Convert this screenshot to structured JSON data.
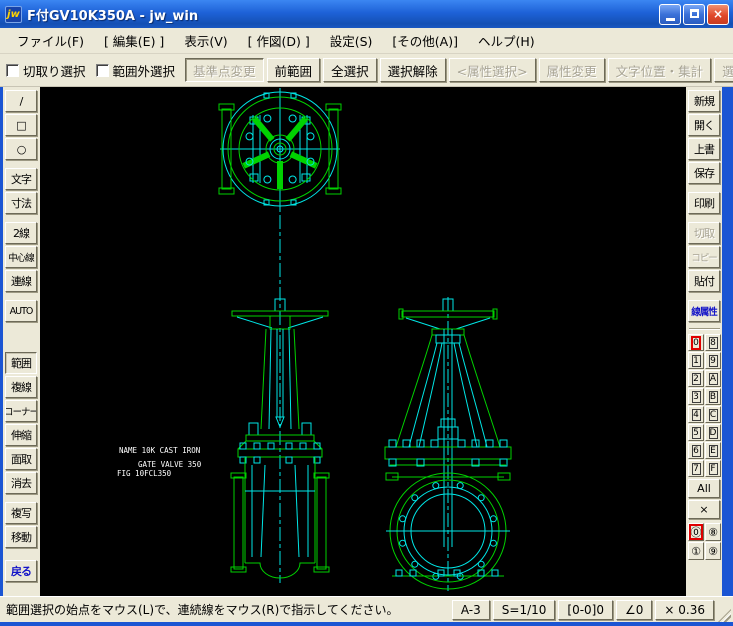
{
  "window": {
    "title": "F付GV10K350A - jw_win",
    "icon_text": "jw",
    "controls": {
      "minimize": "minimize",
      "maximize": "maximize",
      "close": "×"
    }
  },
  "menu": {
    "items": [
      "ファイル(F)",
      "[ 編集(E) ]",
      "表示(V)",
      "[ 作図(D) ]",
      "設定(S)",
      "[その他(A)]",
      "ヘルプ(H)"
    ]
  },
  "select_toolbar": {
    "checkboxes": [
      {
        "label": "切取り選択",
        "checked": false
      },
      {
        "label": "範囲外選択",
        "checked": false
      }
    ],
    "buttons": [
      {
        "label": "基準点変更",
        "enabled": false
      },
      {
        "label": "前範囲",
        "enabled": true
      },
      {
        "label": "全選択",
        "enabled": true
      },
      {
        "label": "選択解除",
        "enabled": true
      },
      {
        "label": "<属性選択>",
        "enabled": false
      },
      {
        "label": "属性変更",
        "enabled": false
      },
      {
        "label": "文字位置・集計",
        "enabled": false
      },
      {
        "label": "選択",
        "enabled": false
      }
    ]
  },
  "left_toolbar": {
    "items": [
      "/",
      "□",
      "○",
      "文字",
      "寸法",
      "2線",
      "中心線",
      "連線",
      "AUTO",
      "範囲",
      "複線",
      "コーナー",
      "伸縮",
      "面取",
      "消去",
      "複写",
      "移動",
      "戻る"
    ],
    "active_item": "範囲"
  },
  "right_toolbar": {
    "buttons": [
      {
        "label": "新規",
        "enabled": true
      },
      {
        "label": "開く",
        "enabled": true
      },
      {
        "label": "上書",
        "enabled": true
      },
      {
        "label": "保存",
        "enabled": true
      },
      {
        "label": "印刷",
        "enabled": true
      },
      {
        "label": "切取",
        "enabled": false
      },
      {
        "label": "コピー",
        "enabled": false
      },
      {
        "label": "貼付",
        "enabled": true
      },
      {
        "label": "線属性",
        "enabled": true
      }
    ],
    "layers": {
      "left_column": [
        "0",
        "1",
        "2",
        "3",
        "4",
        "5",
        "6",
        "7"
      ],
      "right_column": [
        "8",
        "9",
        "A",
        "B",
        "C",
        "D",
        "E",
        "F"
      ],
      "active_layer": "0",
      "all_label": "All",
      "close_label": "×",
      "group_buttons": [
        "⓪",
        "⑧",
        "①",
        "⑨"
      ],
      "active_group": "⓪"
    }
  },
  "canvas": {
    "labels": [
      {
        "text": "NAME  10K CAST IRON"
      },
      {
        "text": "GATE VALVE 350"
      },
      {
        "text": "FIG   10FCL350"
      }
    ],
    "colors": {
      "background": "#000000",
      "outline_green": "#00d200",
      "detail_cyan": "#00e6e6",
      "text": "#ffffff"
    }
  },
  "status_bar": {
    "message": "範囲選択の始点をマウス(L)で、連続線をマウス(R)で指示してください。",
    "paper_size": "A-3",
    "scale": "S=1/10",
    "layer_state": "[0-0]0",
    "angle": "∠0",
    "zoom": "× 0.36"
  }
}
